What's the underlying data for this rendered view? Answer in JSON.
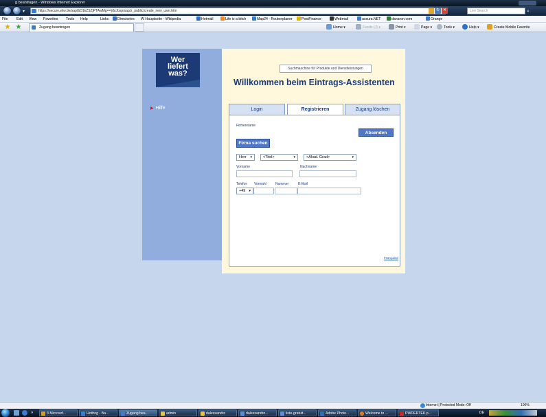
{
  "window": {
    "title": "g beantragen - Windows Internet Explorer"
  },
  "addressbar": {
    "url": "https://secure.wlw.de/sap(bD1kZSZjPTAwMg==)/bc/bsp/sap/z_public/create_new_user.htm",
    "search_placeholder": "Live Search"
  },
  "menu": {
    "items": [
      "File",
      "Edit",
      "View",
      "Favorites",
      "Tools",
      "Help"
    ],
    "links_label": "Links",
    "links": [
      {
        "label": "Directories",
        "icon": "folder-blue-icon",
        "color": "#3a6ec4"
      },
      {
        "label": "W Hauptseite - Wikipedia",
        "icon": "wikipedia-icon",
        "color": "#777777"
      },
      {
        "label": "Hotmail",
        "icon": "msn-icon",
        "color": "#2a6bd1"
      },
      {
        "label": "Life is a bitch",
        "icon": "blogger-icon",
        "color": "#f08a24"
      },
      {
        "label": "Map24 - Routenplaner",
        "icon": "map-icon",
        "color": "#2f7fcf"
      },
      {
        "label": "PostFinance",
        "icon": "postfinance-icon",
        "color": "#e0b400"
      },
      {
        "label": "Webmail",
        "icon": "webmail-icon",
        "color": "#333333"
      },
      {
        "label": "assura.NET",
        "icon": "ie-icon",
        "color": "#3b7bd0"
      },
      {
        "label": "danaron.com",
        "icon": "danaron-icon",
        "color": "#2f7f2f"
      },
      {
        "label": "Orange",
        "icon": "ie-icon",
        "color": "#3b7bd0"
      }
    ]
  },
  "tabs_bar": {
    "tab_title": "Zugang beantragen",
    "commands": [
      "Home",
      "Feeds (J)",
      "Print",
      "Page",
      "Tools",
      "Help",
      "Create Mobile Favorite"
    ]
  },
  "page": {
    "logo_lines": [
      "Wer",
      "liefert",
      "was?"
    ],
    "help_link": "Hilfe",
    "tagline": "Suchmaschine für Produkte und Dienstleistungen",
    "headline": "Willkommen beim Eintrags-Assistenten",
    "tabs": [
      "Login",
      "Registrieren",
      "Zugang löschen"
    ],
    "active_tab": "Registrieren",
    "form": {
      "firmenname_label": "Firmenname",
      "submit_label": "Absenden",
      "search_company_label": "Firma suchen",
      "salutation_value": "Herr",
      "title_value": "<Titel>",
      "degree_value": "<Akad. Grad>",
      "vorname_label": "Vorname",
      "nachname_label": "Nachname",
      "telefon_label": "Telefon",
      "vorwahl_label": "Vorwahl",
      "nummer_label": "Nummer",
      "email_label": "E-Mail",
      "country_code_value": "+49"
    },
    "language_link": "Française"
  },
  "statusbar": {
    "protected_mode": "Internet | Protected Mode: Off",
    "zoom": "100%"
  },
  "taskbar": {
    "buttons": [
      {
        "label": "3 Microsof...",
        "icon": "office-icon",
        "color": "#d8a020"
      },
      {
        "label": "Hotfrog - Ba...",
        "icon": "ie-icon",
        "color": "#3b7bd0"
      },
      {
        "label": "Zugang bea...",
        "icon": "ie-icon",
        "color": "#3b7bd0"
      },
      {
        "label": "admin",
        "icon": "folder-icon",
        "color": "#e8c44a"
      },
      {
        "label": "dalessandro",
        "icon": "folder-icon",
        "color": "#e8c44a"
      },
      {
        "label": "dalessandro...",
        "icon": "window-icon",
        "color": "#5a8fd8"
      },
      {
        "label": "liste-gratuit...",
        "icon": "window-icon",
        "color": "#5a8fd8"
      },
      {
        "label": "Adobe Photo...",
        "icon": "photoshop-icon",
        "color": "#2b6fb8"
      },
      {
        "label": "Welcome to ...",
        "icon": "firefox-icon",
        "color": "#e07a1e"
      },
      {
        "label": "PWDERTEK.p...",
        "icon": "pdf-icon",
        "color": "#c8281e"
      }
    ],
    "language": "DE"
  }
}
